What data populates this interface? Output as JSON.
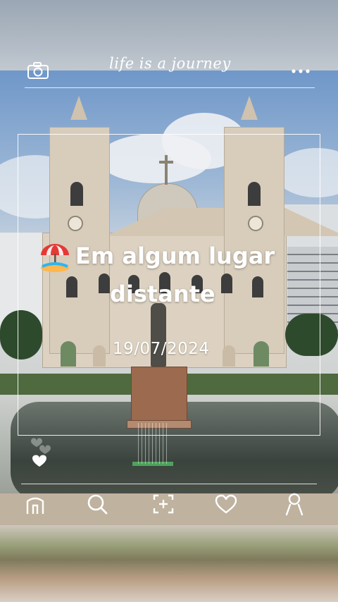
{
  "header": {
    "title": "life is a journey"
  },
  "caption": {
    "line1": "Em algum lugar",
    "line2": "distante",
    "date": "19/07/2024"
  },
  "icons": {
    "camera": "camera-icon",
    "more": "more-dots-icon",
    "emoji": "beach-umbrella-icon",
    "hearts": "hearts-icon",
    "home": "home-icon",
    "search": "search-icon",
    "add": "add-square-icon",
    "like": "heart-icon",
    "profile": "profile-icon"
  },
  "colors": {
    "overlay": "#ffffff",
    "stone": "#d8ccbb",
    "door": "#6e8a63"
  }
}
